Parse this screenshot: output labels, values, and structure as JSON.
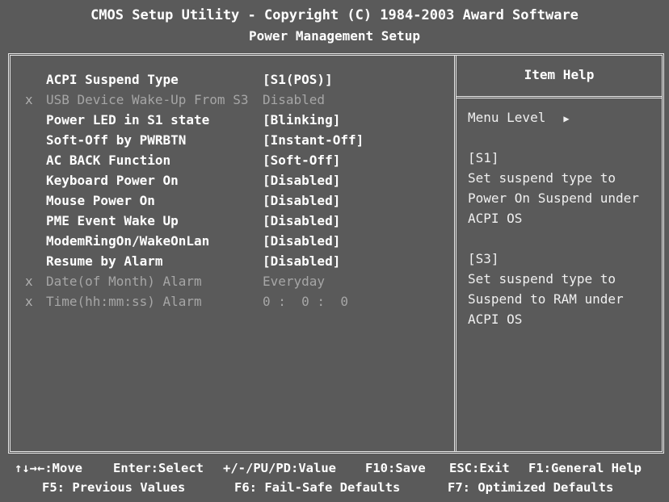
{
  "header": {
    "title": "CMOS Setup Utility - Copyright (C) 1984-2003 Award Software",
    "subtitle": "Power Management Setup"
  },
  "settings": [
    {
      "label": "ACPI Suspend Type",
      "value": "[S1(POS)]",
      "disabled": false,
      "selected": true
    },
    {
      "label": "USB Device Wake-Up From S3",
      "value": "Disabled",
      "disabled": true
    },
    {
      "label": "Power LED in S1 state",
      "value": "[Blinking]",
      "disabled": false
    },
    {
      "label": "Soft-Off by PWRBTN",
      "value": "[Instant-Off]",
      "disabled": false
    },
    {
      "label": "AC BACK Function",
      "value": "[Soft-Off]",
      "disabled": false
    },
    {
      "label": "Keyboard Power On",
      "value": "[Disabled]",
      "disabled": false
    },
    {
      "label": "Mouse Power On",
      "value": "[Disabled]",
      "disabled": false
    },
    {
      "label": "PME Event Wake Up",
      "value": "[Disabled]",
      "disabled": false
    },
    {
      "label": "ModemRingOn/WakeOnLan",
      "value": "[Disabled]",
      "disabled": false
    },
    {
      "label": "Resume by Alarm",
      "value": "[Disabled]",
      "disabled": false
    },
    {
      "label": "Date(of Month) Alarm",
      "value": "Everyday",
      "disabled": true
    },
    {
      "label": "Time(hh:mm:ss) Alarm",
      "value": "0 :  0 :  0",
      "disabled": true
    }
  ],
  "disabled_marker": "x",
  "help": {
    "title": "Item Help",
    "menu_level": "Menu Level",
    "lines": [
      "",
      "[S1]",
      "Set suspend type to",
      "Power On Suspend under",
      "ACPI OS",
      "",
      "[S3]",
      "Set suspend type to",
      "Suspend to RAM under",
      "ACPI OS"
    ]
  },
  "footer": {
    "move": "↑↓→←:Move",
    "enter": "Enter:Select",
    "value": "+/-/PU/PD:Value",
    "save": "F10:Save",
    "exit": "ESC:Exit",
    "help": "F1:General Help",
    "prev": "F5: Previous Values",
    "failsafe": "F6: Fail-Safe Defaults",
    "optimized": "F7: Optimized Defaults"
  }
}
